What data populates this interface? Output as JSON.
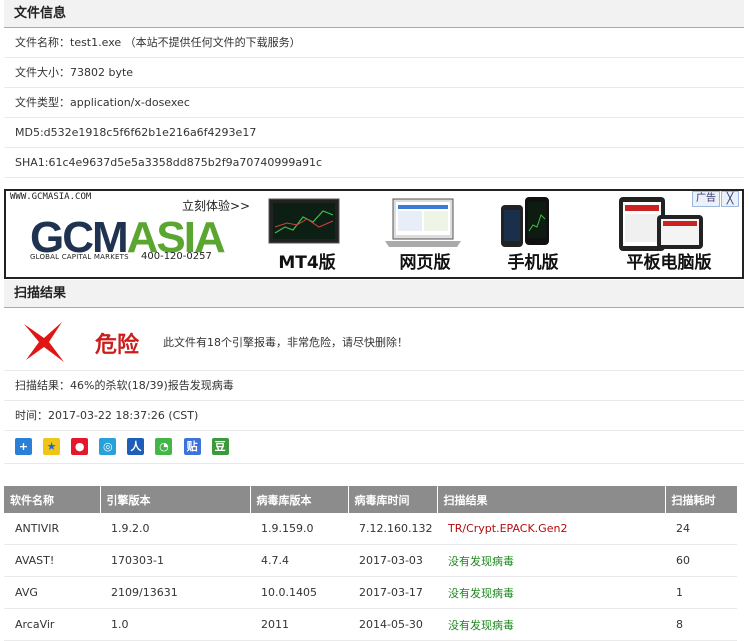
{
  "file_info": {
    "section_title": "文件信息",
    "rows": [
      {
        "label": "文件名称：",
        "value": "test1.exe （本站不提供任何文件的下载服务）"
      },
      {
        "label": "文件大小：",
        "value": "73802 byte"
      },
      {
        "label": "文件类型：",
        "value": "application/x-dosexec"
      },
      {
        "label": "MD5:",
        "value": "d532e1918c5f6f62b1e216a6f4293e17"
      },
      {
        "label": "SHA1:",
        "value": "61c4e9637d5e5a3358dd875b2f9a70740999a91c"
      }
    ]
  },
  "ad": {
    "url": "WWW.GCMASIA.COM",
    "cta": "立刻体验>>",
    "logo_part1": "GCM",
    "logo_part2": "ASIA",
    "tagline": "GLOBAL CAPITAL MARKETS",
    "phone": "400-120-0257",
    "products": [
      "MT4版",
      "网页版",
      "手机版",
      "平板电脑版"
    ],
    "badge": "广告",
    "close": "╳"
  },
  "scan": {
    "section_title": "扫描结果",
    "status": "危险",
    "status_color": "#cc1d1d",
    "description": "此文件有18个引擎报毒，非常危险，请尽快删除！",
    "summary": "扫描结果：46%的杀软(18/39)报告发现病毒",
    "time": "时间：2017-03-22 18:37:26 (CST)",
    "share_icons": [
      "plus-share-icon",
      "qzone-icon",
      "weibo-icon",
      "tencent-weibo-icon",
      "renren-icon",
      "wechat-icon",
      "tieba-icon",
      "douban-icon"
    ]
  },
  "table": {
    "headers": [
      "软件名称",
      "引擎版本",
      "病毒库版本",
      "病毒库时间",
      "扫描结果",
      "扫描耗时"
    ],
    "rows": [
      {
        "name": "ANTIVIR",
        "engine": "1.9.2.0",
        "db": "1.9.159.0",
        "db_time": "7.12.160.132",
        "result": "TR/Crypt.EPACK.Gen2",
        "status": "bad",
        "time": "24"
      },
      {
        "name": "AVAST!",
        "engine": "170303-1",
        "db": "4.7.4",
        "db_time": "2017-03-03",
        "result": "没有发现病毒",
        "status": "ok",
        "time": "60"
      },
      {
        "name": "AVG",
        "engine": "2109/13631",
        "db": "10.0.1405",
        "db_time": "2017-03-17",
        "result": "没有发现病毒",
        "status": "ok",
        "time": "1"
      },
      {
        "name": "ArcaVir",
        "engine": "1.0",
        "db": "2011",
        "db_time": "2014-05-30",
        "result": "没有发现病毒",
        "status": "ok",
        "time": "8"
      }
    ]
  }
}
